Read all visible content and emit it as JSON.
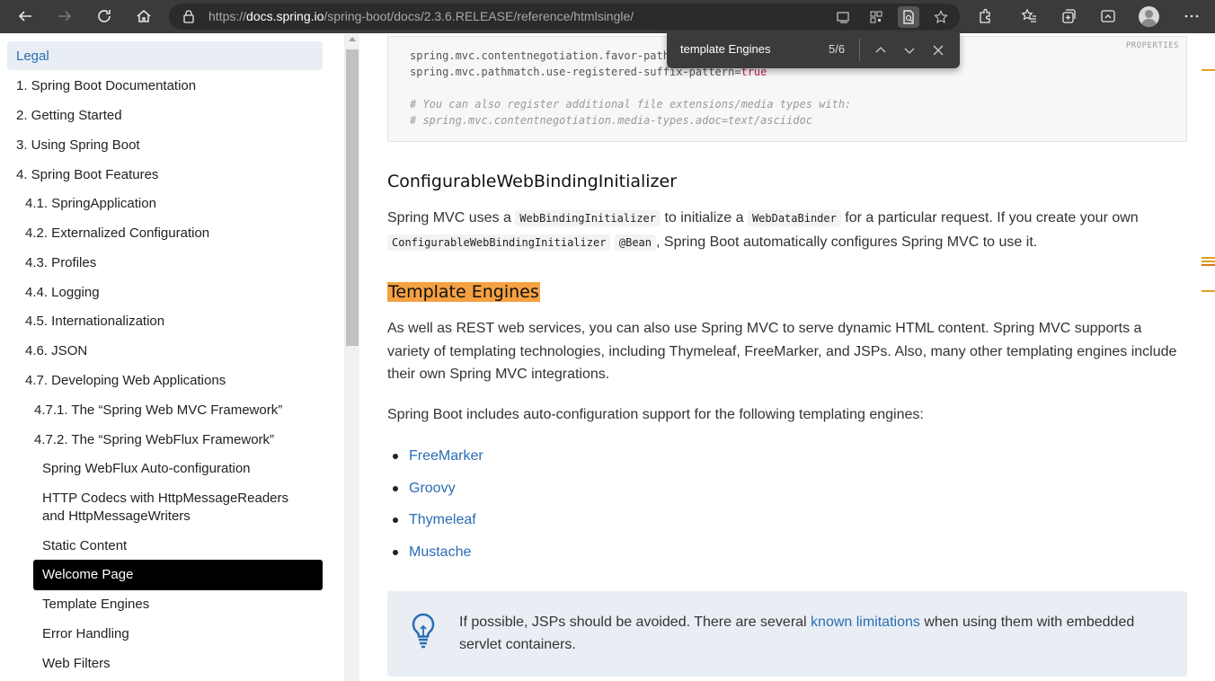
{
  "browser": {
    "url_prefix": "https://",
    "url_host": "docs.spring.io",
    "url_path": "/spring-boot/docs/2.3.6.RELEASE/reference/htmlsingle/"
  },
  "find": {
    "query": "template Engines",
    "count": "5/6"
  },
  "sidebar": {
    "items": [
      {
        "label": "Legal"
      },
      {
        "label": "1. Spring Boot Documentation"
      },
      {
        "label": "2. Getting Started"
      },
      {
        "label": "3. Using Spring Boot"
      },
      {
        "label": "4. Spring Boot Features"
      },
      {
        "label": "4.1. SpringApplication"
      },
      {
        "label": "4.2. Externalized Configuration"
      },
      {
        "label": "4.3. Profiles"
      },
      {
        "label": "4.4. Logging"
      },
      {
        "label": "4.5. Internationalization"
      },
      {
        "label": "4.6. JSON"
      },
      {
        "label": "4.7. Developing Web Applications"
      },
      {
        "label": "4.7.1. The “Spring Web MVC Framework”"
      },
      {
        "label": "4.7.2. The “Spring WebFlux Framework”"
      },
      {
        "label": "Spring WebFlux Auto-configuration"
      },
      {
        "label": "HTTP Codecs with HttpMessageReaders"
      },
      {
        "label": "and HttpMessageWriters"
      },
      {
        "label": "Static Content"
      },
      {
        "label": "Welcome Page"
      },
      {
        "label": "Template Engines"
      },
      {
        "label": "Error Handling"
      },
      {
        "label": "Web Filters"
      }
    ]
  },
  "code": {
    "label": "PROPERTIES",
    "line1": "spring.mvc.contentnegotiation.favor-path",
    "line2_key": "spring.mvc.pathmatch.use-registered-suffix-pattern=",
    "line2_val": "true",
    "comment1": "# You can also register additional file extensions/media types with:",
    "comment2": "# spring.mvc.contentnegotiation.media-types.adoc=text/asciidoc"
  },
  "content": {
    "h_binding": "ConfigurableWebBindingInitializer",
    "binding_p1": "Spring MVC uses a ",
    "binding_code1": "WebBindingInitializer",
    "binding_p2": " to initialize a ",
    "binding_code2": "WebDataBinder",
    "binding_p3": " for a particular request. If you create your own",
    "binding_code3": "ConfigurableWebBindingInitializer",
    "binding_code4": "@Bean",
    "binding_p4": ", Spring Boot automatically configures Spring MVC to use it.",
    "h_templates": "Template Engines",
    "templates_p": "As well as REST web services, you can also use Spring MVC to serve dynamic HTML content. Spring MVC supports a variety of templating technologies, including Thymeleaf, FreeMarker, and JSPs. Also, many other templating engines include their own Spring MVC integrations.",
    "includes_p": "Spring Boot includes auto-configuration support for the following templating engines:",
    "engines": [
      {
        "label": "FreeMarker"
      },
      {
        "label": "Groovy"
      },
      {
        "label": "Thymeleaf"
      },
      {
        "label": "Mustache"
      }
    ],
    "tip_p1": "If possible, JSPs should be avoided. There are several ",
    "tip_link": "known limitations",
    "tip_p2": " when using them with embedded servlet containers."
  },
  "colors": {
    "highlight": "#f5a142",
    "link": "#2a6db3",
    "selected_bg": "#000000"
  }
}
